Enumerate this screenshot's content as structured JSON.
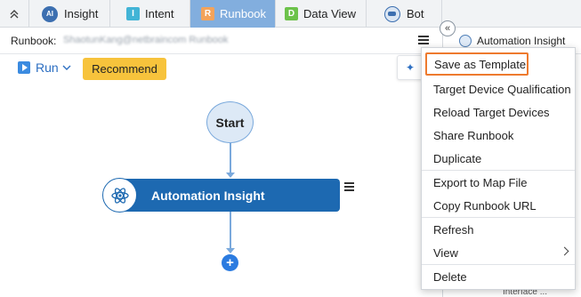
{
  "tabs": [
    {
      "label": "Insight",
      "icon": "ai-icon",
      "active": false
    },
    {
      "label": "Intent",
      "icon": "intent-icon",
      "icon_letter": "I",
      "active": false
    },
    {
      "label": "Runbook",
      "icon": "runbook-icon",
      "icon_letter": "R",
      "active": true
    },
    {
      "label": "Data View",
      "icon": "data-view-icon",
      "icon_letter": "D",
      "active": false
    },
    {
      "label": "Bot",
      "icon": "bot-icon",
      "active": false
    }
  ],
  "runbook": {
    "label": "Runbook:",
    "name": "ShaotunKang@netbraincom Runbook"
  },
  "right_panel": {
    "title": "Automation Insight",
    "bottom_fragment": "Interface ..."
  },
  "toolbar": {
    "run_label": "Run",
    "recommend_label": "Recommend"
  },
  "flow": {
    "start_label": "Start",
    "node_label": "Automation Insight"
  },
  "menu": {
    "items": [
      {
        "label": "Save as Template",
        "highlighted": true
      },
      {
        "label": "Target Device Qualification"
      },
      {
        "label": "Reload Target Devices"
      },
      {
        "label": "Share Runbook"
      },
      {
        "label": "Duplicate"
      },
      {
        "label": "Export to Map File"
      },
      {
        "label": "Copy Runbook URL"
      },
      {
        "label": "Refresh"
      },
      {
        "label": "View",
        "has_submenu": true
      },
      {
        "label": "Delete"
      }
    ]
  },
  "colors": {
    "active_tab": "#82aede",
    "node_blue": "#1d69b1",
    "recommend": "#f7c33c",
    "highlight_border": "#ee7a2e"
  }
}
